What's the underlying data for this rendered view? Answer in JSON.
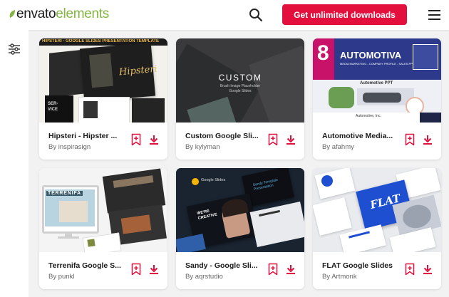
{
  "header": {
    "logo_part1": "envato",
    "logo_part2": "elements",
    "cta_label": "Get unlimited downloads",
    "colors": {
      "accent": "#e3103d",
      "brand_green": "#82b541"
    }
  },
  "icons": {
    "search": "search-icon",
    "menu": "hamburger-menu-icon",
    "filter": "filter-sliders-icon",
    "bookmark": "bookmark-add-icon",
    "download": "download-icon"
  },
  "cards": [
    {
      "title": "Hipsteri - Hipster ...",
      "author": "By inspirasign",
      "thumb_banner": "HIPSTERI - GOOGLE SLIDES PRESENTATION TEMPLATE",
      "thumb_text": "Hipsteri",
      "thumb_small": "SER- VICE"
    },
    {
      "title": "Custom Google Sli...",
      "author": "By kylyman",
      "thumb_text": "CUSTOM",
      "thumb_sub1": "Brush Image Placeholder",
      "thumb_sub2": "Google Slides"
    },
    {
      "title": "Automotive Media...",
      "author": "By afahmy",
      "thumb_text": "AUTOMOTIVA",
      "thumb_sub1": "MEDIA MARKETING - COMPANY PROFILE - SALES PPT",
      "thumb_small": "Automotive PPT",
      "thumb_small2": "Automotive, Inc."
    },
    {
      "title": "Terrenifa Google S...",
      "author": "By punkl",
      "thumb_text": "TERRENIFA"
    },
    {
      "title": "Sandy - Google Sli...",
      "author": "By aqrstudio",
      "thumb_text": "Google Slides",
      "thumb_sub1": "Sandy Template Presentation",
      "thumb_small": "WE'RE CREATIVE"
    },
    {
      "title": "FLAT Google Slides",
      "author": "By Artmonk",
      "thumb_text": "FLAT"
    }
  ]
}
